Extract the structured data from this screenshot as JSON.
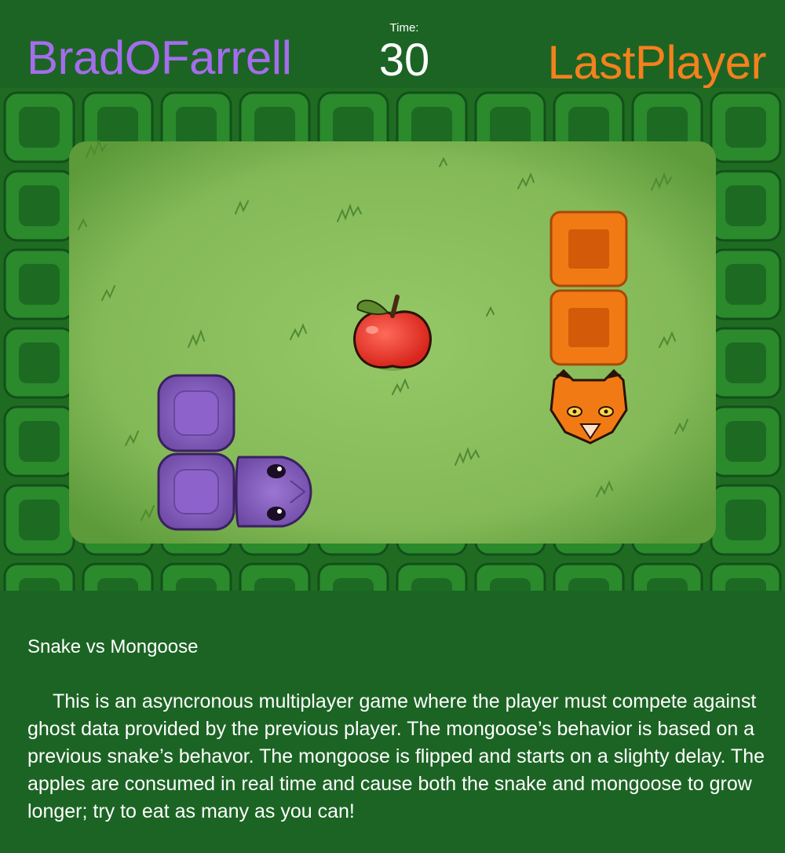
{
  "header": {
    "player_one": "BradOFarrell",
    "player_two": "LastPlayer",
    "timer_label": "Time:",
    "timer_value": "30"
  },
  "colors": {
    "player_one": "#a46ded",
    "player_two": "#f4801e",
    "hedge": "#1f6b22",
    "field": "#8cc15c"
  },
  "game": {
    "snake_segments": 3,
    "mongoose_segments": 3,
    "apples": 1
  },
  "description": {
    "title": "Snake vs Mongoose",
    "body": "This is an asyncronous multiplayer game where the player must compete against ghost data provided by the previous player. The mongoose’s behavior is based on a previous snake’s behavor. The mongoose is flipped and starts on a slighty delay. The apples are consumed in real time and cause both the snake and mongoose to grow longer; try to eat as many as you can!"
  }
}
